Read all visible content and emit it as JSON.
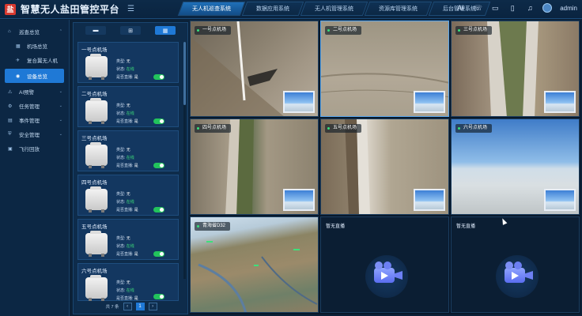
{
  "app": {
    "title": "智慧无人盐田管控平台",
    "logo_text": "盐"
  },
  "top_tabs": [
    {
      "label": "无人机巡查系统",
      "active": true
    },
    {
      "label": "数据应用系统",
      "active": false
    },
    {
      "label": "无人机管理系统",
      "active": false
    },
    {
      "label": "资源库管理系统",
      "active": false
    },
    {
      "label": "后台管理系统",
      "active": false
    }
  ],
  "header_right": {
    "ai_label": "Ai",
    "user": "admin"
  },
  "sidebar": {
    "items": [
      {
        "label": "巡查总览",
        "icon": "home-icon",
        "glyph": "⌂",
        "chev": "⌃"
      },
      {
        "label": "机场总览",
        "icon": "grid-icon",
        "glyph": "▦",
        "sub": true
      },
      {
        "label": "复合翼无人机",
        "icon": "plane-icon",
        "glyph": "✈",
        "sub": true
      },
      {
        "label": "设备总览",
        "icon": "device-icon",
        "glyph": "◉",
        "sub": true,
        "active": true
      },
      {
        "label": "AI预警",
        "icon": "ai-icon",
        "glyph": "⚠",
        "chev": "⌄"
      },
      {
        "label": "任务管理",
        "icon": "task-icon",
        "glyph": "⚙",
        "chev": "⌄"
      },
      {
        "label": "事件管理",
        "icon": "event-icon",
        "glyph": "▤",
        "chev": "⌄"
      },
      {
        "label": "安全管理",
        "icon": "shield-icon",
        "glyph": "⛨",
        "chev": "⌄"
      },
      {
        "label": "飞行回放",
        "icon": "replay-icon",
        "glyph": "▣"
      }
    ]
  },
  "device_panel": {
    "labels": {
      "type": "类型:",
      "status": "状态:",
      "live": "是否直播:"
    },
    "cards": [
      {
        "name": "一号点机场",
        "type": "无",
        "status": "在线",
        "live": "是"
      },
      {
        "name": "二号点机场",
        "type": "无",
        "status": "在线",
        "live": "是"
      },
      {
        "name": "三号点机场",
        "type": "无",
        "status": "在线",
        "live": "是"
      },
      {
        "name": "四号点机场",
        "type": "无",
        "status": "在线",
        "live": "是"
      },
      {
        "name": "五号点机场",
        "type": "无",
        "status": "在线",
        "live": "是"
      },
      {
        "name": "六号点机场",
        "type": "无",
        "status": "在线",
        "live": "是"
      }
    ],
    "pagination": {
      "total": "共 7 条",
      "prev": "‹",
      "current": "1",
      "next": "›"
    }
  },
  "videos": [
    {
      "label": "一号点机场",
      "live": true
    },
    {
      "label": "二号点机场",
      "live": true
    },
    {
      "label": "三号点机场",
      "live": true
    },
    {
      "label": "四号点机场",
      "live": true
    },
    {
      "label": "五号点机场",
      "live": true
    },
    {
      "label": "六号点机场",
      "live": true
    },
    {
      "label": "青海省D32",
      "live": true
    },
    {
      "label": "暂无直播",
      "live": false
    },
    {
      "label": "暂无直播",
      "live": false
    }
  ],
  "colors": {
    "accent": "#1f79d6",
    "online": "#3ee07a",
    "brand_red": "#d93a30"
  }
}
